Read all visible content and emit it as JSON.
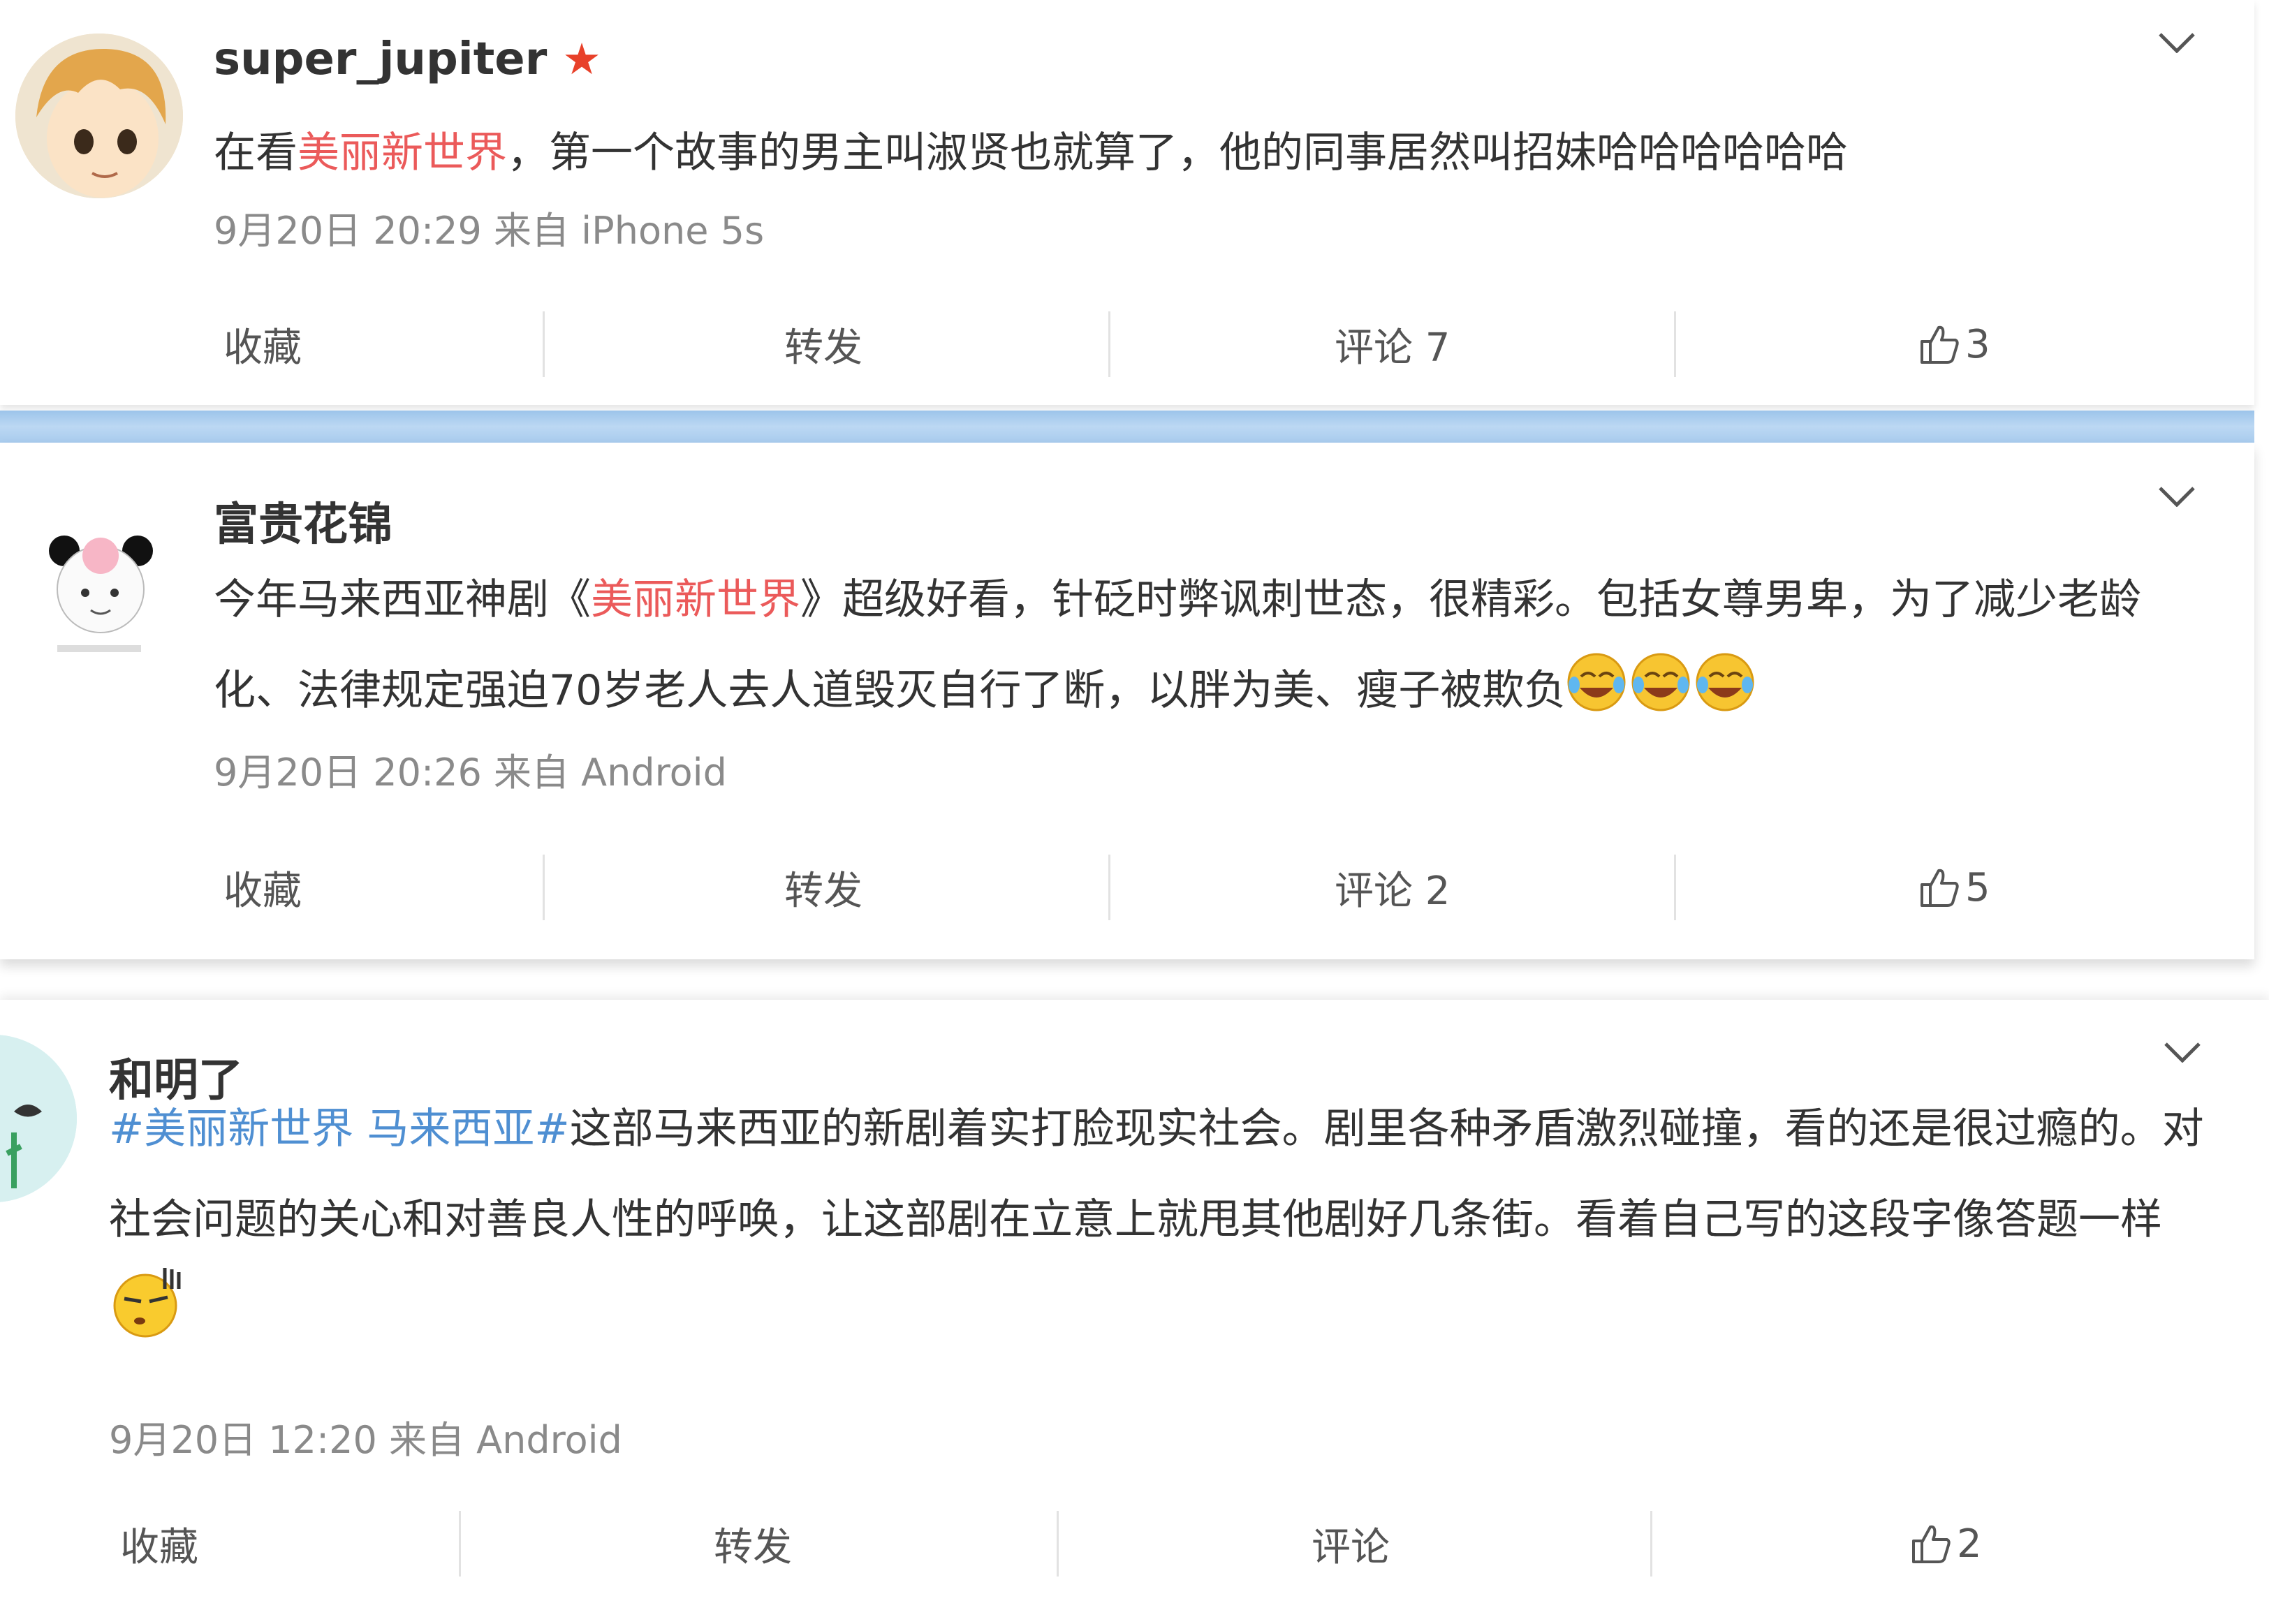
{
  "posts": [
    {
      "user": "super_jupiter",
      "star": "★",
      "text_pre": "在看",
      "text_hl": "美丽新世界",
      "text_post": "，第一个故事的男主叫淑贤也就算了，他的同事居然叫招妹哈哈哈哈哈哈",
      "meta": "9月20日 20:29 来自 iPhone 5s",
      "actions": {
        "fav": "收藏",
        "repost": "转发",
        "comment": "评论 7",
        "likes": "3"
      }
    },
    {
      "user": "富贵花锦",
      "text_pre": "今年马来西亚神剧《",
      "text_hl": "美丽新世界",
      "text_post": "》超级好看，针砭时弊讽刺世态，很精彩。包括女尊男卑，为了减少老龄化、法律规定强迫70岁老人去人道毁灭自行了断，以胖为美、瘦子被欺负",
      "emoji": "laugh-cry-emoji",
      "meta": "9月20日 20:26 来自 Android",
      "actions": {
        "fav": "收藏",
        "repost": "转发",
        "comment": "评论 2",
        "likes": "5"
      }
    },
    {
      "user": "和明了",
      "tag1": "#美丽新世界",
      "tag2": "马来西亚#",
      "text_post": "这部马来西亚的新剧着实打脸现实社会。剧里各种矛盾激烈碰撞，看的还是很过瘾的。对社会问题的关心和对善良人性的呼唤，让这部剧在立意上就甩其他剧好几条街。看着自己写的这段字像答题一样",
      "emoji": "smug-emoji",
      "meta": "9月20日 12:20 来自 Android",
      "actions": {
        "fav": "收藏",
        "repost": "转发",
        "comment": "评论",
        "likes": "2"
      }
    }
  ],
  "colors": {
    "highlight": "#eb5a5a",
    "tag": "#4f8fd2",
    "separator": "#a8cbed"
  }
}
